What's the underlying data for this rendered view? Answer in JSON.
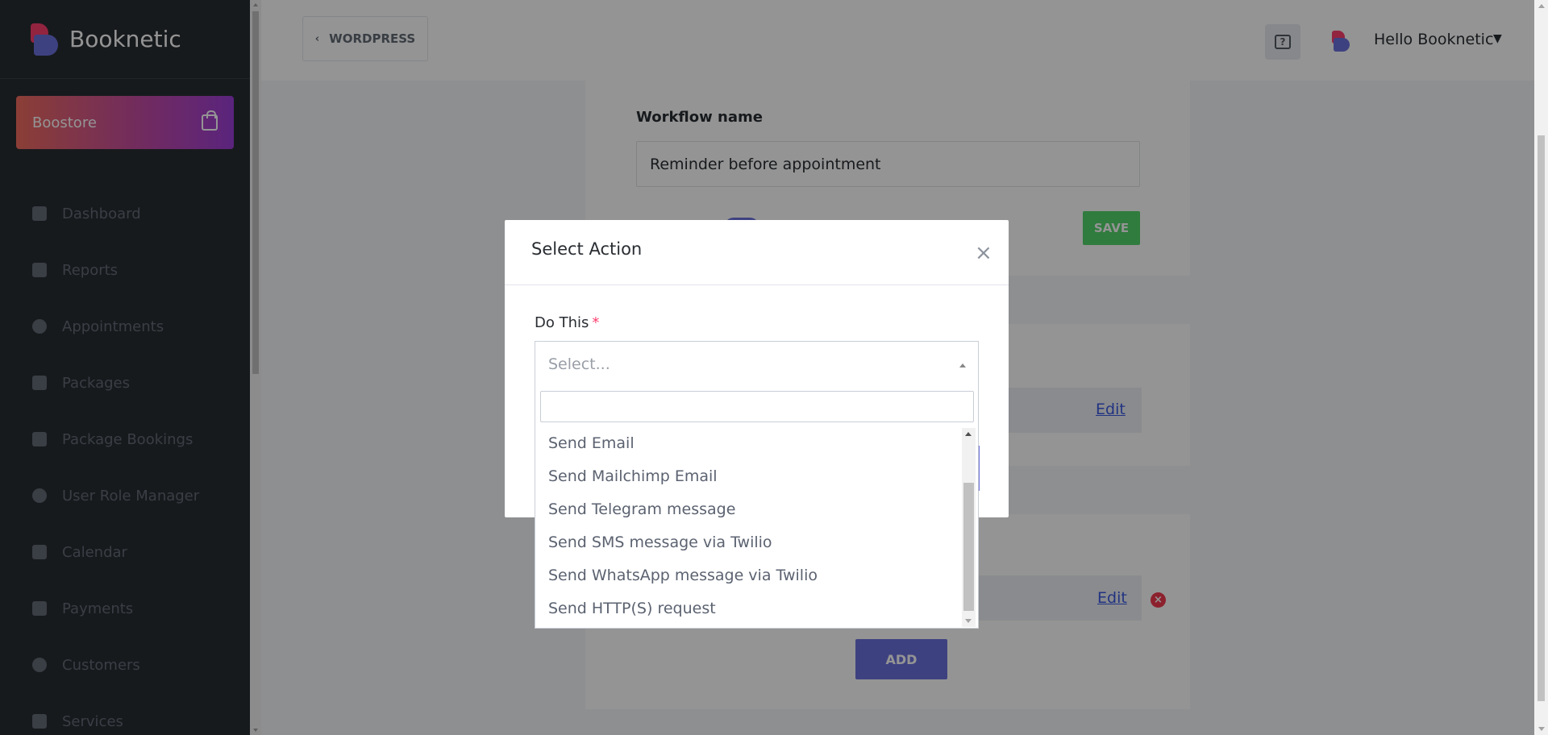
{
  "brand": {
    "name": "Booknetic"
  },
  "sidebar": {
    "boostore_label": "Boostore",
    "items": [
      {
        "label": "Dashboard",
        "icon": "cube-icon"
      },
      {
        "label": "Reports",
        "icon": "chart-line-icon"
      },
      {
        "label": "Appointments",
        "icon": "clock-icon"
      },
      {
        "label": "Packages",
        "icon": "boxes-icon"
      },
      {
        "label": "Package Bookings",
        "icon": "box-open-icon"
      },
      {
        "label": "User Role Manager",
        "icon": "user-plus-icon"
      },
      {
        "label": "Calendar",
        "icon": "calendar-icon"
      },
      {
        "label": "Payments",
        "icon": "wallet-icon"
      },
      {
        "label": "Customers",
        "icon": "users-icon"
      },
      {
        "label": "Services",
        "icon": "list-icon"
      }
    ]
  },
  "header": {
    "back_label": "WORDPRESS",
    "user_greeting": "Hello Booknetic"
  },
  "workflow": {
    "name_label": "Workflow name",
    "name_value": "Reminder before appointment",
    "save_label": "SAVE",
    "edit_label": "Edit",
    "add_label": "ADD"
  },
  "modal": {
    "title": "Select Action",
    "do_label": "Do This",
    "required_mark": "*",
    "select_placeholder": "Select...",
    "options": [
      "Send Email",
      "Send Mailchimp Email",
      "Send Telegram message",
      "Send SMS message via Twilio",
      "Send WhatsApp message via Twilio",
      "Send HTTP(S) request"
    ]
  },
  "colors": {
    "sidebar_bg": "#292d32",
    "accent": "#6c70dc",
    "brand_red": "#fb3e6e",
    "save_green": "#53d56c"
  }
}
